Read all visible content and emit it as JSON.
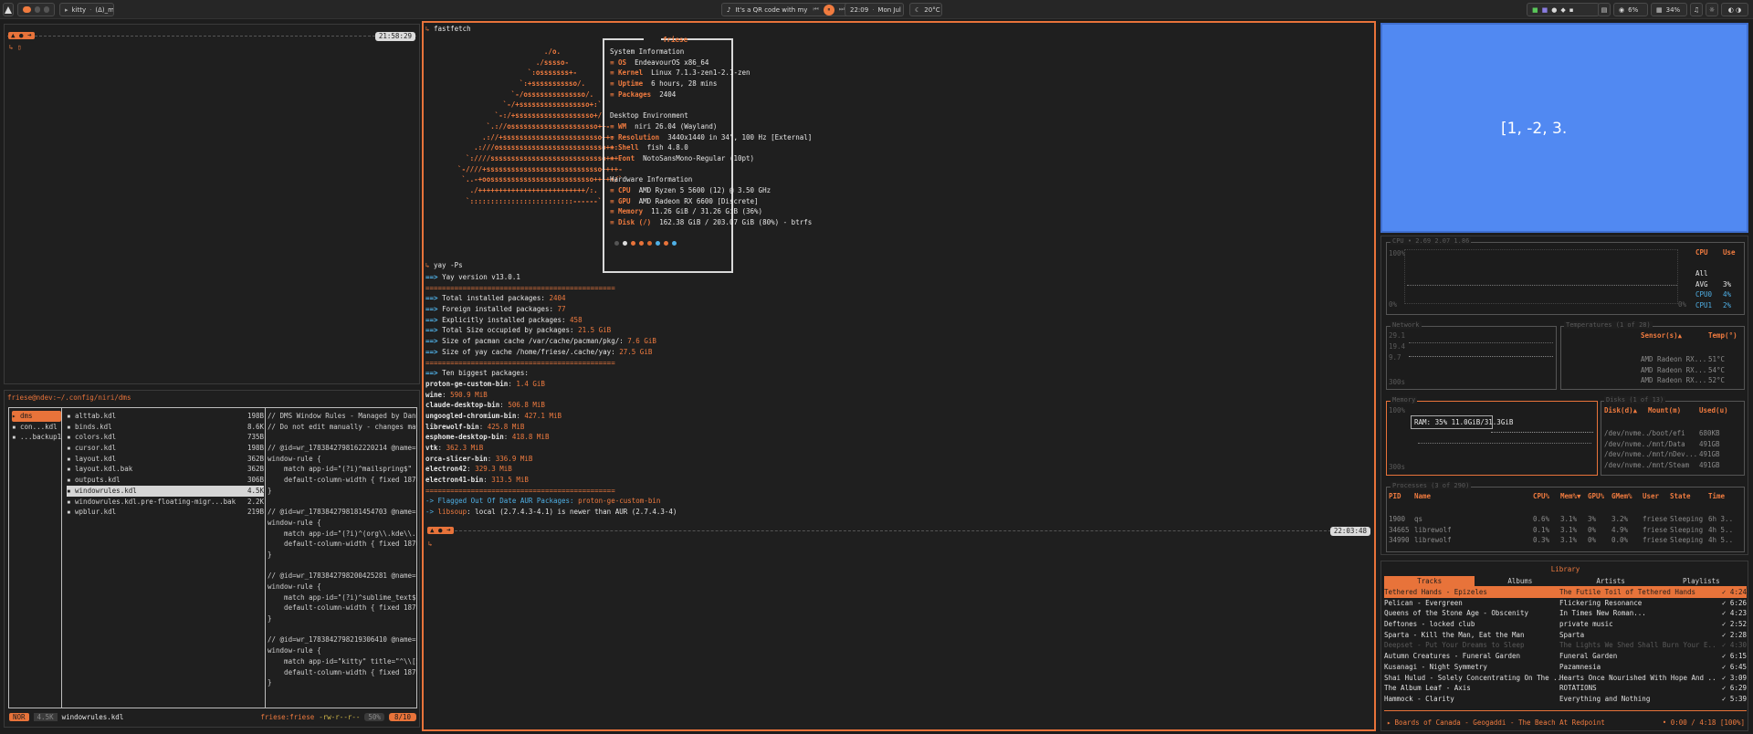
{
  "bar": {
    "terminal": "kitty",
    "folder": "(Δ)_main",
    "media": "It's a QR code with my bar",
    "time": "22:09",
    "date": "Mon Jul 13",
    "weather": "20°C",
    "cpu": "6%",
    "ram": "34%"
  },
  "left_top": {
    "clock": "21:58:29"
  },
  "yazi": {
    "path": "friese@ndev:~/.config/niri/dms",
    "col1": [
      "dms",
      "con...kdl",
      "...backup17..."
    ],
    "files": [
      {
        "n": "alttab.kdl",
        "s": "198B"
      },
      {
        "n": "binds.kdl",
        "s": "8.6K"
      },
      {
        "n": "colors.kdl",
        "s": "735B"
      },
      {
        "n": "cursor.kdl",
        "s": "198B"
      },
      {
        "n": "layout.kdl",
        "s": "362B"
      },
      {
        "n": "layout.kdl.bak",
        "s": "362B"
      },
      {
        "n": "outputs.kdl",
        "s": "306B"
      },
      {
        "n": "windowrules.kdl",
        "s": "4.5K"
      },
      {
        "n": "windowrules.kdl.pre-floating-migr...bak",
        "s": "2.2K"
      },
      {
        "n": "wpblur.kdl",
        "s": "219B"
      }
    ],
    "preview": [
      "// DMS Window Rules - Managed by Dank",
      "// Do not edit manually - changes may",
      "",
      "// @id=wr_1783842798162220214 @name=",
      "window-rule {",
      "    match app-id=\"(?i)^mailspring$\"",
      "    default-column-width { fixed 1870",
      "}",
      "",
      "// @id=wr_1783842798181454703 @name=",
      "window-rule {",
      "    match app-id=\"(?i)^(org\\\\.kde\\\\.)",
      "    default-column-width { fixed 1870",
      "}",
      "",
      "// @id=wr_1783842798200425281 @name=",
      "window-rule {",
      "    match app-id=\"(?i)^sublime_text$\"",
      "    default-column-width { fixed 1870",
      "}",
      "",
      "// @id=wr_1783842798219306410 @name=",
      "window-rule {",
      "    match app-id=\"kitty\" title=\"^\\\\[5",
      "    default-column-width { fixed 1870",
      "}"
    ],
    "status_mode": "NOR",
    "status_size": "4.5K",
    "status_file": "windowrules.kdl",
    "status_user": "friese:friese",
    "status_perm": "-rw-r--r--",
    "status_pct": "50%",
    "status_pos": "8/10"
  },
  "fastfetch": {
    "cmd": "fastfetch",
    "user": "friese",
    "logo": [
      "                           ./o.",
      "                         ./sssso-",
      "                       `:osssssss+-",
      "                     `:+sssssssssso/.",
      "                   `-/ossssssssssssso/.",
      "                 `-/+sssssssssssssssso+:`",
      "               `-:/+sssssssssssssssssso+/.",
      "             `.://osssssssssssssssssssso++-",
      "            .://+ssssssssssssssssssssssso++:",
      "          .:///ossssssssssssssssssssssssso++:",
      "        `:////ssssssssssssssssssssssssssso+++.",
      "      `-////+ssssssssssssssssssssssssssso++++-",
      "       `..-+oosssssssssssssssssssssssso+++++/`",
      "         ./++++++++++++++++++++++++++/:.",
      "        `:::::::::::::::::::::::::------``"
    ],
    "sections": [
      {
        "h": "System Information",
        "rows": [
          [
            "OS",
            "EndeavourOS x86_64"
          ],
          [
            "Kernel",
            "Linux 7.1.3-zen1-2.1-zen"
          ],
          [
            "Uptime",
            "6 hours, 28 mins"
          ],
          [
            "Packages",
            "2404"
          ]
        ]
      },
      {
        "h": "Desktop Environment",
        "rows": [
          [
            "WM",
            "niri 26.04 (Wayland)"
          ],
          [
            "Resolution",
            "3440x1440 in 34\", 100 Hz [External]"
          ],
          [
            "Shell",
            "fish 4.8.0"
          ],
          [
            "Font",
            "NotoSansMono-Regular (10pt)"
          ]
        ]
      },
      {
        "h": "Hardware Information",
        "rows": [
          [
            "CPU",
            "AMD Ryzen 5 5600 (12) @ 3.50 GHz"
          ],
          [
            "GPU",
            "AMD Radeon RX 6600 [Discrete]"
          ],
          [
            "Memory",
            "11.26 GiB / 31.26 GiB (36%)"
          ],
          [
            "Disk (/)",
            "162.38 GiB / 203.07 GiB (80%) - btrfs"
          ]
        ]
      }
    ]
  },
  "yay": {
    "cmd": "yay -Ps",
    "version": "Yay version v13.0.1",
    "sep": "==============================================",
    "stats": [
      [
        "Total installed packages: ",
        "2404"
      ],
      [
        "Foreign installed packages: ",
        "77"
      ],
      [
        "Explicitly installed packages: ",
        "458"
      ],
      [
        "Total Size occupied by packages: ",
        "21.5 GiB"
      ],
      [
        "Size of pacman cache /var/cache/pacman/pkg/: ",
        "7.6 GiB"
      ],
      [
        "Size of yay cache /home/friese/.cache/yay: ",
        "27.5 GiB"
      ]
    ],
    "biggest_h": "Ten biggest packages:",
    "biggest": [
      [
        "proton-ge-custom-bin",
        "1.4 GiB"
      ],
      [
        "wine",
        "590.9 MiB"
      ],
      [
        "claude-desktop-bin",
        "506.8 MiB"
      ],
      [
        "ungoogled-chromium-bin",
        "427.1 MiB"
      ],
      [
        "librewolf-bin",
        "425.8 MiB"
      ],
      [
        "esphome-desktop-bin",
        "418.8 MiB"
      ],
      [
        "vtk",
        "362.3 MiB"
      ],
      [
        "orca-slicer-bin",
        "336.9 MiB"
      ],
      [
        "electron42",
        "329.3 MiB"
      ],
      [
        "electron41-bin",
        "313.5 MiB"
      ]
    ],
    "flag": "-> Flagged Out Of Date AUR Packages: ",
    "flag_pkg": "proton-ge-custom-bin",
    "newer_a": "-> ",
    "newer_pkg": "libsoup",
    "newer_b": ": local (2.7.4.3-4.1) is newer than AUR (2.7.4.3-4)",
    "clock": "22:03:48"
  },
  "qr_text": "[1, -2, 3.",
  "btop": {
    "cpu_title": "CPU • 2.69 2.07 1.86",
    "cpu_h": [
      "CPU",
      "Use"
    ],
    "cpu_rows": [
      [
        "All",
        ""
      ],
      [
        "AVG",
        "3%"
      ],
      [
        "CPU0",
        "4%"
      ],
      [
        "CPU1",
        "2%"
      ]
    ],
    "net_title": "Network",
    "net_vals": [
      "29.1",
      "19.4",
      "9.7"
    ],
    "net_bottom": "300s",
    "temp_title": "Temperatures (1 of 28)",
    "temp_h": [
      "Sensor(s)▲",
      "Temp(°)"
    ],
    "temps": [
      [
        "AMD Radeon RX...",
        "51°C"
      ],
      [
        "AMD Radeon RX...",
        "54°C"
      ],
      [
        "AMD Radeon RX...",
        "52°C"
      ]
    ],
    "mem_title": "Memory",
    "mem_pct": "100%",
    "mem_label": "RAM: 35%  11.0GiB/31.3GiB",
    "mem_bottom": "300s",
    "disk_title": "Disks (1 of 13)",
    "disk_h": [
      "Disk(d)▲",
      "Mount(m)",
      "Used(u)"
    ],
    "disks": [
      [
        "/dev/nvme...",
        "/boot/efi",
        "680KB"
      ],
      [
        "/dev/nvme...",
        "/mnt/Data",
        "491GB"
      ],
      [
        "/dev/nvme...",
        "/mnt/nDev...",
        "491GB"
      ],
      [
        "/dev/nvme...",
        "/mnt/Steam",
        "491GB"
      ]
    ],
    "proc_title": "Processes (3 of 290)",
    "proc_h": [
      "PID",
      "Name",
      "CPU%",
      "Mem%▼",
      "GPU%",
      "GMem%",
      "User",
      "State",
      "Time"
    ],
    "procs": [
      [
        "1900",
        "qs",
        "0.6%",
        "3.1%",
        "3%",
        "3.2%",
        "friese",
        "Sleeping",
        "6h 3.."
      ],
      [
        "34665",
        "librewolf",
        "0.1%",
        "3.1%",
        "0%",
        "4.9%",
        "friese",
        "Sleeping",
        "4h 5.."
      ],
      [
        "34990",
        "librewolf",
        "0.3%",
        "3.1%",
        "0%",
        "0.0%",
        "friese",
        "Sleeping",
        "4h 5.."
      ]
    ]
  },
  "music": {
    "title": "Library",
    "tabs": [
      "Tracks",
      "Albums",
      "Artists",
      "Playlists"
    ],
    "tracks": [
      [
        "Tethered Hands - Epizeles",
        "The Futile Toil of Tethered Hands",
        "✓ 4:24"
      ],
      [
        "Pelican - Evergreen",
        "Flickering Resonance",
        "✓ 6:26"
      ],
      [
        "Queens of the Stone Age - Obscenity",
        "In Times New Roman...",
        "✓ 4:23"
      ],
      [
        "Deftones - locked club",
        "private music",
        "✓ 2:52"
      ],
      [
        "Spartа - Kill the Man, Eat the Man",
        "Spartа",
        "✓ 2:28"
      ],
      [
        "Deepset - Put Your Dreams to Sleep",
        "The Lights We Shed Shall Burn Your E..",
        "✓ 4:30"
      ],
      [
        "Autumn Creatures - Funeral Garden",
        "Funeral Garden",
        "✓ 6:15"
      ],
      [
        "Kusanagi - Night Symmetry",
        "Pazamnesia",
        "✓ 6:45"
      ],
      [
        "Shai Hulud - Solely Concentrating On The ..",
        "Hearts Once Nourished With Hope And ..",
        "✓ 3:09"
      ],
      [
        "The Album Leaf - Axis",
        "ROTATIONS",
        "✓ 6:29"
      ],
      [
        "Hammock - Clarity",
        "Everything and Nothing",
        "✓ 5:39"
      ]
    ],
    "now": "Boards of Canada - Geogaddi - The Beach At Redpoint",
    "progress": "• 0:00 / 4:18 [100%]"
  }
}
